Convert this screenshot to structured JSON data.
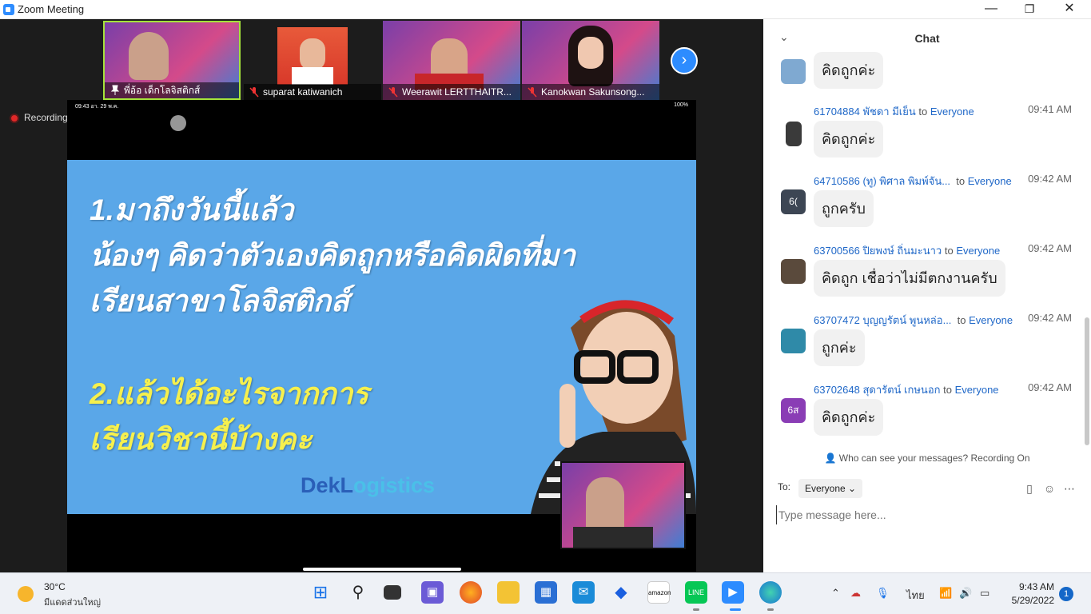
{
  "window": {
    "title": "Zoom Meeting",
    "minimize": "—",
    "maximize": "❐",
    "close": "✕"
  },
  "participants": [
    {
      "name": "พี่อ้อ เด็กโลจิสติกส์",
      "muted": false
    },
    {
      "name": "suparat katiwanich",
      "muted": true
    },
    {
      "name": "Weerawit LERTTHAITR...",
      "muted": true
    },
    {
      "name": "Kanokwan Sakunsong...",
      "muted": true
    }
  ],
  "next_arrow": "›",
  "recording_label": "Recording",
  "share": {
    "phone_time": "09:43  อา. 29 พ.ค.",
    "phone_battery": "100%",
    "question1_lines": [
      "1.มาถึงวันนี้แล้ว",
      "น้องๆ คิดว่าตัวเองคิดถูกหรือคิดผิดที่มา",
      "เรียนสาขาโลจิสติกส์"
    ],
    "question2_lines": [
      "2.แล้วได้อะไรจากการ",
      "เรียนวิชานี้บ้างคะ"
    ],
    "logo_a": "DekL",
    "logo_b": "ogistics"
  },
  "chat": {
    "title": "Chat",
    "messages": [
      {
        "sender": "",
        "to": "",
        "recipient": "",
        "time": "",
        "text": "คิดถูกค่ะ",
        "avatar_text": "",
        "avatar_color": "#7fa9d1"
      },
      {
        "sender": "61704884 พัชดา มีเย็น",
        "to": "to",
        "recipient": "Everyone",
        "time": "09:41 AM",
        "text": "คิดถูกค่ะ",
        "avatar_text": "",
        "avatar_color": "#3a3a3a"
      },
      {
        "sender": "64710586 (ทู) พิศาล  พิมพ์จัน...",
        "to": "to",
        "recipient": "Everyone",
        "time": "09:42 AM",
        "text": "ถูกครับ",
        "avatar_text": "6(",
        "avatar_color": "#3d4654"
      },
      {
        "sender": "63700566 ปิยพงษ์ ถิ่นมะนาว",
        "to": "to",
        "recipient": "Everyone",
        "time": "09:42 AM",
        "text": "คิดถูก เชื่อว่าไม่มีตกงานครับ",
        "avatar_text": "",
        "avatar_color": "#5a4a3c"
      },
      {
        "sender": "63707472 บุญญรัตน์ พูนหล่อ...",
        "to": "to",
        "recipient": "Everyone",
        "time": "09:42 AM",
        "text": "ถูกค่ะ",
        "avatar_text": "",
        "avatar_color": "#2f8aa8"
      },
      {
        "sender": "63702648 สุดารัตน์ เกษนอก",
        "to": "to",
        "recipient": "Everyone",
        "time": "09:42 AM",
        "text": "คิดถูกค่ะ",
        "avatar_text": "6ส",
        "avatar_color": "#8a3db5"
      }
    ],
    "privacy_note": "Who can see your messages? Recording On",
    "to_label": "To:",
    "to_value": "Everyone",
    "input_placeholder": "Type message here..."
  },
  "taskbar": {
    "weather_temp": "30°C",
    "weather_cond": "มีแดดส่วนใหญ่",
    "lang": "ไทย",
    "time": "9:43 AM",
    "date": "5/29/2022",
    "notifications": "1"
  }
}
